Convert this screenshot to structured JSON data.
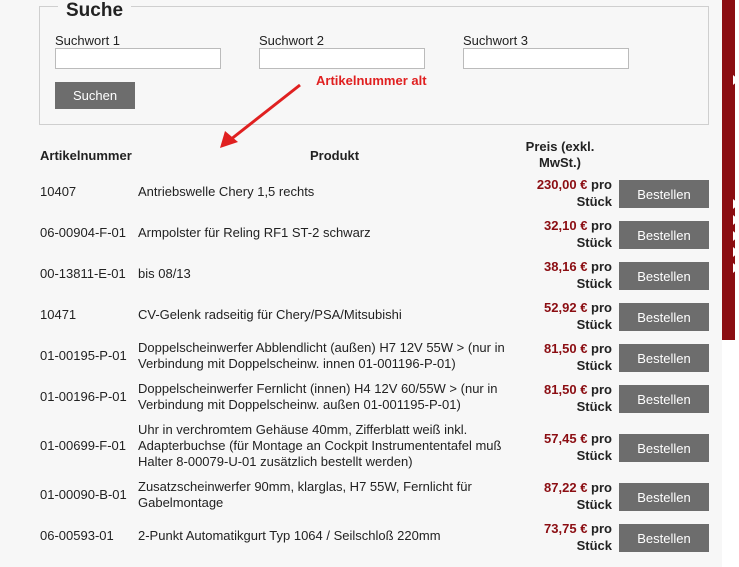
{
  "search": {
    "legend": "Suche",
    "fields": [
      {
        "label": "Suchwort 1",
        "value": ""
      },
      {
        "label": "Suchwort 2",
        "value": ""
      },
      {
        "label": "Suchwort 3",
        "value": ""
      }
    ],
    "button_label": "Suchen"
  },
  "annotation": {
    "text": "Artikelnummer alt",
    "color": "#e02020"
  },
  "table": {
    "headers": {
      "article": "Artikelnummer",
      "product": "Produkt",
      "price": "Preis (exkl. MwSt.)"
    },
    "order_label": "Bestellen",
    "unit_label": "pro Stück",
    "rows": [
      {
        "id": "10407",
        "product": "Antriebswelle Chery 1,5 rechts",
        "price": "230,00 €"
      },
      {
        "id": "06-00904-F-01",
        "product": "Armpolster für Reling RF1 ST-2 schwarz",
        "price": "32,10 €"
      },
      {
        "id": "00-13811-E-01",
        "product": "bis 08/13",
        "price": "38,16 €"
      },
      {
        "id": "10471",
        "product": "CV-Gelenk radseitig für Chery/PSA/Mitsubishi",
        "price": "52,92 €"
      },
      {
        "id": "01-00195-P-01",
        "product": "Doppelscheinwerfer Abblendlicht (außen) H7 12V 55W > (nur in Verbindung mit Doppelscheinw. innen 01-001196-P-01)",
        "price": "81,50 €"
      },
      {
        "id": "01-00196-P-01",
        "product": "Doppelscheinwerfer Fernlicht (innen) H4 12V 60/55W > (nur in Verbindung mit Doppelscheinw. außen 01-001195-P-01)",
        "price": "81,50 €"
      },
      {
        "id": "01-00699-F-01",
        "product": "Uhr in verchromtem Gehäuse 40mm, Zifferblatt weiß inkl. Adapterbuchse (für Montage an Cockpit Instrumententafel muß Halter 8-00079-U-01 zusätzlich bestellt werden)",
        "price": "57,45 €"
      },
      {
        "id": "01-00090-B-01",
        "product": "Zusatzscheinwerfer 90mm, klarglas, H7 55W, Fernlicht für Gabelmontage",
        "price": "87,22 €"
      },
      {
        "id": "06-00593-01",
        "product": "2-Punkt Automatikgurt Typ 1064 / Seilschloß 220mm",
        "price": "73,75 €"
      }
    ]
  },
  "colors": {
    "accent": "#8b0d12",
    "button": "#6d6d6d"
  }
}
